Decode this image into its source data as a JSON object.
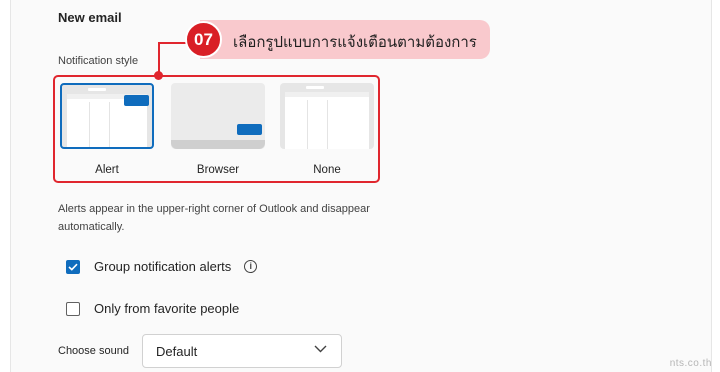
{
  "section": {
    "title": "New email"
  },
  "notification_style": {
    "label": "Notification style",
    "options": [
      {
        "label": "Alert",
        "selected": true
      },
      {
        "label": "Browser",
        "selected": false
      },
      {
        "label": "None",
        "selected": false
      }
    ]
  },
  "callout": {
    "number": "07",
    "text": "เลือกรูปแบบการแจ้งเตือนตามต้องการ",
    "colors": {
      "badge": "#d91f26",
      "bar": "#f9c9cd",
      "outline": "#e0262e"
    }
  },
  "description": "Alerts appear in the upper-right corner of Outlook and disappear automatically.",
  "group_alerts": {
    "label": "Group notification alerts",
    "checked": true
  },
  "favorites_only": {
    "label": "Only from favorite people",
    "checked": false
  },
  "sound": {
    "label": "Choose sound",
    "value": "Default"
  },
  "watermark": "nts.co.th",
  "accent_color": "#0f6cbd"
}
